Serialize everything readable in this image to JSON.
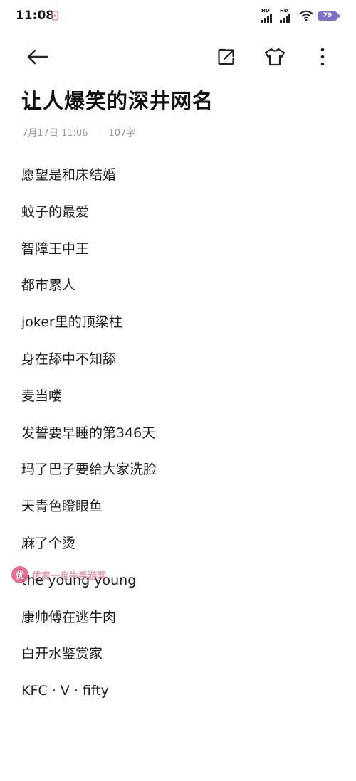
{
  "status": {
    "time": "11:08",
    "signal1_label": "HD",
    "signal2_label": "HD",
    "battery": "79",
    "battery_color": "#7e71c9"
  },
  "toolbar": {
    "back_icon": "arrow-left-icon",
    "share_icon": "share-icon",
    "theme_icon": "tshirt-icon",
    "more_icon": "more-vertical-icon"
  },
  "note": {
    "title": "让人爆笑的深井网名",
    "date": "7月17日 11:06",
    "word_count": "107字",
    "lines": [
      "愿望是和床结婚",
      "蚊子的最爱",
      "智障王中王",
      "都市累人",
      "joker里的顶梁柱",
      "身在舔中不知舔",
      "麦当喽",
      "发誓要早睡的第346天",
      "玛了巴子要给大家洗脸",
      "天青色瞪眼鱼",
      "麻了个烫",
      "the young young",
      "康帅傅在逃牛肉",
      "白开水鉴赏家",
      "KFC · V · fifty"
    ]
  },
  "watermark": {
    "text": "优麦一定牛手游网",
    "accent": "#e24a7a"
  }
}
